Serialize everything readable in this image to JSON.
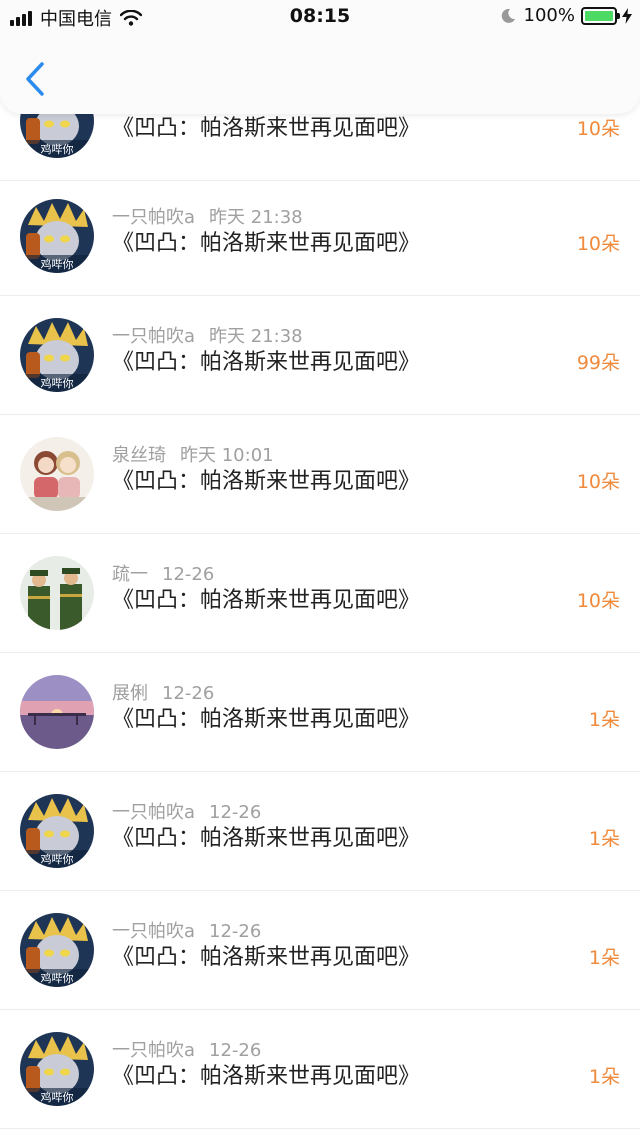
{
  "status_bar": {
    "carrier": "中国电信",
    "time": "08:15",
    "battery": "100%"
  },
  "header": {
    "back_icon": "chevron-left-icon"
  },
  "colors": {
    "accent": "#2b8cee",
    "amount": "#f08a3c",
    "meta": "#a0a0a0"
  },
  "items": [
    {
      "name": "",
      "time": "",
      "title": "《凹凸：帕洛斯来世再见面吧》",
      "amount": "10朵",
      "avatar_caption": "鸡哔你",
      "avatar": "anime-avatar-icon"
    },
    {
      "name": "一只帕吹a",
      "time": "昨天 21:38",
      "title": "《凹凸：帕洛斯来世再见面吧》",
      "amount": "10朵",
      "avatar_caption": "鸡哔你",
      "avatar": "anime-avatar-icon"
    },
    {
      "name": "一只帕吹a",
      "time": "昨天 21:38",
      "title": "《凹凸：帕洛斯来世再见面吧》",
      "amount": "99朵",
      "avatar_caption": "鸡哔你",
      "avatar": "anime-avatar-icon"
    },
    {
      "name": "泉丝琦",
      "time": "昨天 10:01",
      "title": "《凹凸：帕洛斯来世再见面吧》",
      "amount": "10朵",
      "avatar_caption": "",
      "avatar": "dolls-avatar-icon"
    },
    {
      "name": "疏一",
      "time": "12-26",
      "title": "《凹凸：帕洛斯来世再见面吧》",
      "amount": "10朵",
      "avatar_caption": "",
      "avatar": "soldiers-avatar-icon"
    },
    {
      "name": "展俐",
      "time": "12-26",
      "title": "《凹凸：帕洛斯来世再见面吧》",
      "amount": "1朵",
      "avatar_caption": "",
      "avatar": "sunset-avatar-icon"
    },
    {
      "name": "一只帕吹a",
      "time": "12-26",
      "title": "《凹凸：帕洛斯来世再见面吧》",
      "amount": "1朵",
      "avatar_caption": "鸡哔你",
      "avatar": "anime-avatar-icon"
    },
    {
      "name": "一只帕吹a",
      "time": "12-26",
      "title": "《凹凸：帕洛斯来世再见面吧》",
      "amount": "1朵",
      "avatar_caption": "鸡哔你",
      "avatar": "anime-avatar-icon"
    },
    {
      "name": "一只帕吹a",
      "time": "12-26",
      "title": "《凹凸：帕洛斯来世再见面吧》",
      "amount": "1朵",
      "avatar_caption": "鸡哔你",
      "avatar": "anime-avatar-icon"
    }
  ]
}
